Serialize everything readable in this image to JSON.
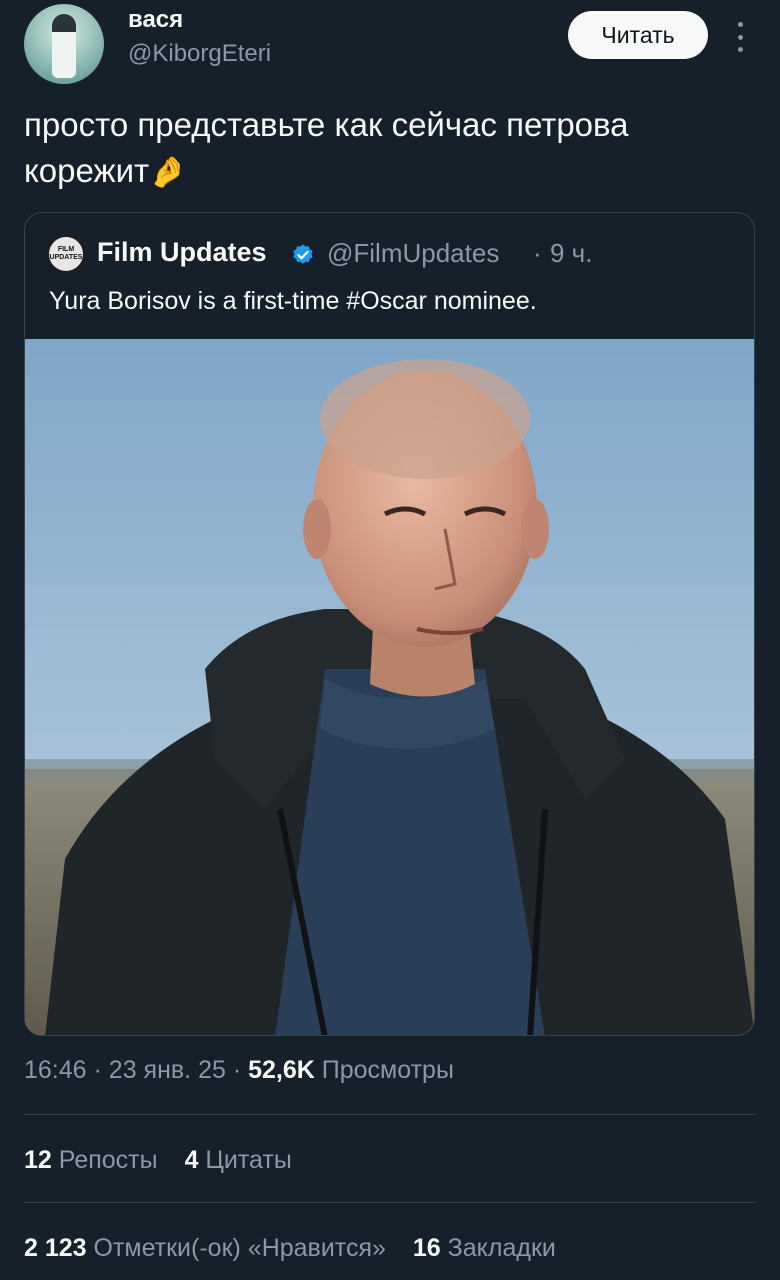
{
  "author": {
    "name": "вася",
    "handle": "@KiborgEteri",
    "follow_label": "Читать"
  },
  "tweet": {
    "text": "просто представьте как сейчас петрова корежит",
    "emoji_icon": "pinching-hand-icon"
  },
  "quoted": {
    "avatar_text": "FILM UPDATES",
    "name": "Film Updates",
    "handle": "@FilmUpdates",
    "separator": "·",
    "time": "9 ч.",
    "text": "Yura Borisov is a first-time #Oscar nominee.",
    "verified_color": "#1d9bf0"
  },
  "meta": {
    "time": "16:46",
    "sep1": "·",
    "date": "23 янв. 25",
    "sep2": "·",
    "views_count": "52,6K",
    "views_label": "Просмотры"
  },
  "stats_row1": [
    {
      "count": "12",
      "label": "Репосты"
    },
    {
      "count": "4",
      "label": "Цитаты"
    }
  ],
  "stats_row2": [
    {
      "count": "2 123",
      "label": "Отметки(-ок) «Нравится»"
    },
    {
      "count": "16",
      "label": "Закладки"
    }
  ],
  "colors": {
    "background": "#15202b",
    "muted": "#8b98a5",
    "border": "#38444d",
    "accent": "#1d9bf0"
  }
}
